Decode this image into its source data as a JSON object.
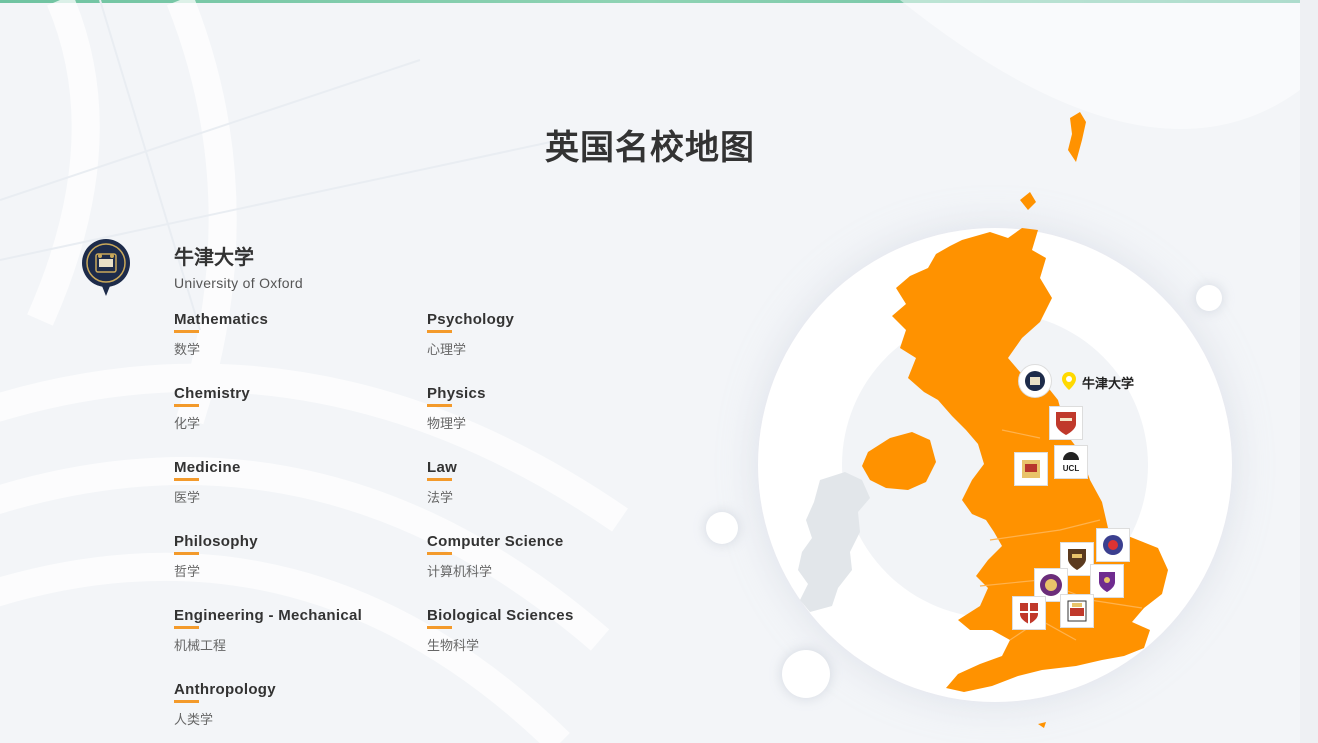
{
  "page": {
    "title": "英国名校地图"
  },
  "university": {
    "name_cn": "牛津大学",
    "name_en": "University of Oxford",
    "logo_icon": "oxford-crest-icon"
  },
  "subjects": [
    {
      "en": "Mathematics",
      "cn": "数学"
    },
    {
      "en": "Psychology",
      "cn": "心理学"
    },
    {
      "en": "Chemistry",
      "cn": "化学"
    },
    {
      "en": "Physics",
      "cn": "物理学"
    },
    {
      "en": "Medicine",
      "cn": "医学"
    },
    {
      "en": "Law",
      "cn": "法学"
    },
    {
      "en": "Philosophy",
      "cn": "哲学"
    },
    {
      "en": "Computer Science",
      "cn": "计算机科学"
    },
    {
      "en": "Engineering - Mechanical",
      "cn": "机械工程"
    },
    {
      "en": "Biological Sciences",
      "cn": "生物科学"
    },
    {
      "en": "Anthropology",
      "cn": "人类学"
    }
  ],
  "map": {
    "selected_label": "牛津大学",
    "pin_icon": "location-pin-icon",
    "uk_color": "#ff9200",
    "ireland_color": "#e2e6ea",
    "pin_color": "#ffd900",
    "badges": [
      "oxford-badge-icon",
      "cambridge-badge-icon",
      "durham-badge-icon",
      "ucl-badge-icon",
      "edinburgh-badge-icon",
      "kings-badge-icon",
      "imperial-badge-icon",
      "lse-badge-icon",
      "bristol-badge-icon",
      "warwick-badge-icon"
    ]
  },
  "colors": {
    "accent": "#f39a2b",
    "top_bar": "#6fc3a1"
  }
}
